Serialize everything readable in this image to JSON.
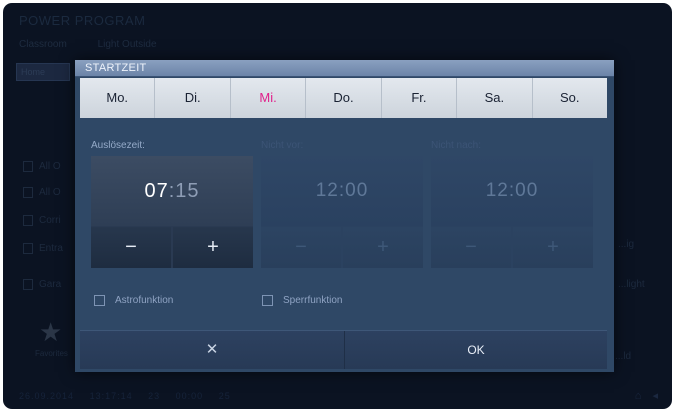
{
  "background": {
    "title": "POWER PROGRAM",
    "subtitle": [
      "Classroom",
      "Light Outside"
    ],
    "tab": "Home",
    "rows": [
      "All O",
      "All O",
      "Corri",
      "Entra",
      "Gara"
    ],
    "star_label": "Favorites",
    "side": [
      "...ig",
      "...light",
      "...ld"
    ],
    "status": [
      "26.09.2014",
      "13:17:14",
      "23",
      "00:00",
      "25"
    ]
  },
  "dialog": {
    "title": "STARTZEIT",
    "days": [
      {
        "label": "Mo.",
        "active": false
      },
      {
        "label": "Di.",
        "active": false
      },
      {
        "label": "Mi.",
        "active": true
      },
      {
        "label": "Do.",
        "active": false
      },
      {
        "label": "Fr.",
        "active": false
      },
      {
        "label": "Sa.",
        "active": false
      },
      {
        "label": "So.",
        "active": false
      }
    ],
    "trigger_time": {
      "label": "Auslösezeit:",
      "hours": "07",
      "separator": ":",
      "minutes": "15",
      "minus": "−",
      "plus": "+"
    },
    "not_before": {
      "label": "Nicht vor:",
      "value": "12:00",
      "minus": "−",
      "plus": "+"
    },
    "not_after": {
      "label": "Nicht nach:",
      "value": "12:00",
      "minus": "−",
      "plus": "+"
    },
    "astro_label": "Astrofunktion",
    "lock_label": "Sperrfunktion",
    "cancel_symbol": "✕",
    "ok_label": "OK"
  },
  "colors": {
    "active_day": "#e0208a",
    "dialog_bg": "#2f4866",
    "header_bg": "#7f96b8"
  }
}
